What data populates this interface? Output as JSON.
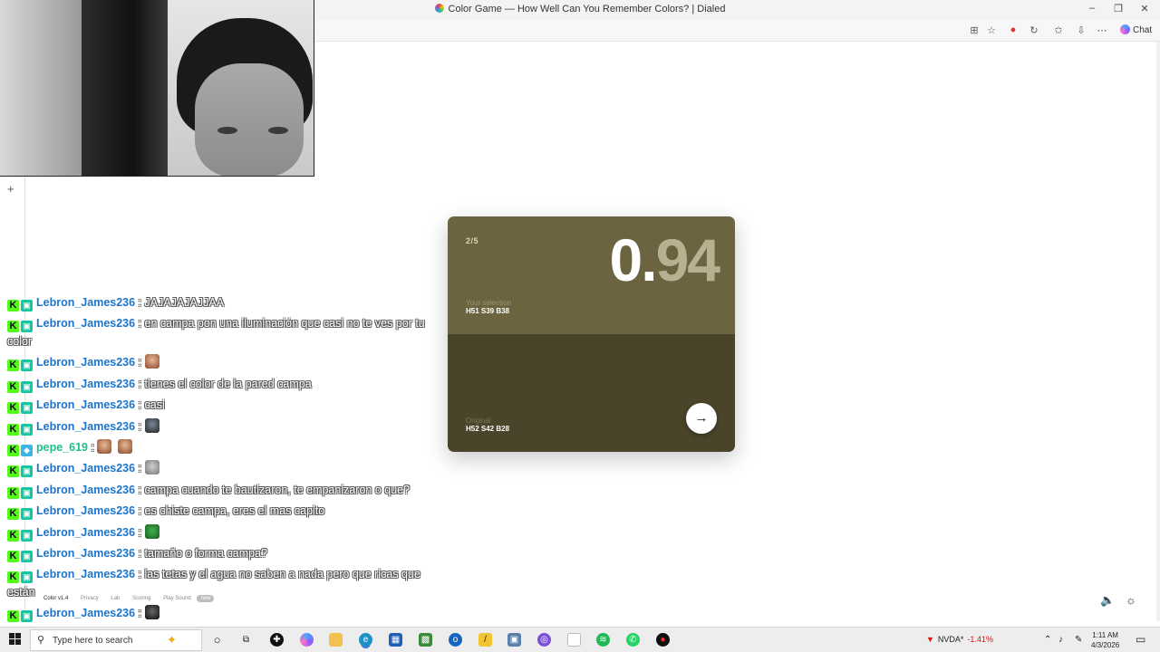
{
  "browser": {
    "title": "Color Game — How Well Can You Remember Colors? | Dialed",
    "chat_label": "Chat",
    "window_minimize": "–",
    "window_restore": "❐",
    "window_close": "✕"
  },
  "game": {
    "round": "2/5",
    "score_int": "0.",
    "score_dec": "94",
    "selection_label": "Your selection",
    "selection_value": "H51 S39 B38",
    "original_label": "Original",
    "original_value": "H52 S42 B28",
    "colors": {
      "selection": "#6c6440",
      "original": "#4a442b"
    }
  },
  "chat": {
    "messages": [
      {
        "user": "Lebron_James236",
        "text": ": JAJAJAJAJJAA",
        "badges": [
          "kick",
          "sub"
        ]
      },
      {
        "user": "Lebron_James236",
        "text": ": en campa pon una iluminación que casi no te ves por tu color",
        "badges": [
          "kick",
          "sub"
        ]
      },
      {
        "user": "Lebron_James236",
        "text": ":",
        "emote": "em1",
        "badges": [
          "kick",
          "sub"
        ]
      },
      {
        "user": "Lebron_James236",
        "text": ": tienes el color de la pared campa",
        "badges": [
          "kick",
          "sub"
        ]
      },
      {
        "user": "Lebron_James236",
        "text": ": casi",
        "badges": [
          "kick",
          "sub"
        ]
      },
      {
        "user": "Lebron_James236",
        "text": ":",
        "emote": "em2",
        "badges": [
          "kick",
          "sub"
        ]
      },
      {
        "user": "pepe_619",
        "text": ":",
        "emote": "em1",
        "emote2": "em1",
        "badges": [
          "kick",
          "bot"
        ]
      },
      {
        "user": "Lebron_James236",
        "text": ":",
        "emote": "em3",
        "badges": [
          "kick",
          "sub"
        ]
      },
      {
        "user": "Lebron_James236",
        "text": ": campa cuando te bautizaron, te empanizaron o que?",
        "badges": [
          "kick",
          "sub"
        ]
      },
      {
        "user": "Lebron_James236",
        "text": ": es chiste campa, eres el mas capito",
        "badges": [
          "kick",
          "sub"
        ]
      },
      {
        "user": "Lebron_James236",
        "text": ":",
        "emote": "em4",
        "badges": [
          "kick",
          "sub"
        ]
      },
      {
        "user": "Lebron_James236",
        "text": ": tamaño o forma campa?",
        "badges": [
          "kick",
          "sub"
        ]
      },
      {
        "user": "Lebron_James236",
        "text": ": las tetas y el agua no saben a nada pero que ricas que están",
        "badges": [
          "kick",
          "sub"
        ]
      },
      {
        "user": "Lebron_James236",
        "text": ":",
        "emote": "em5",
        "badges": [
          "kick",
          "sub"
        ]
      }
    ]
  },
  "footer": {
    "version": "Color v1.4",
    "privacy": "Privacy",
    "lab": "Lab",
    "scoring": "Scoring",
    "play_sound": "Play Sound",
    "new_tag": "new"
  },
  "taskbar": {
    "search_placeholder": "Type here to search",
    "stock_name": "NVDA*",
    "stock_change": "-1.41%",
    "time": "1:11 AM",
    "date": "4/3/2026"
  }
}
